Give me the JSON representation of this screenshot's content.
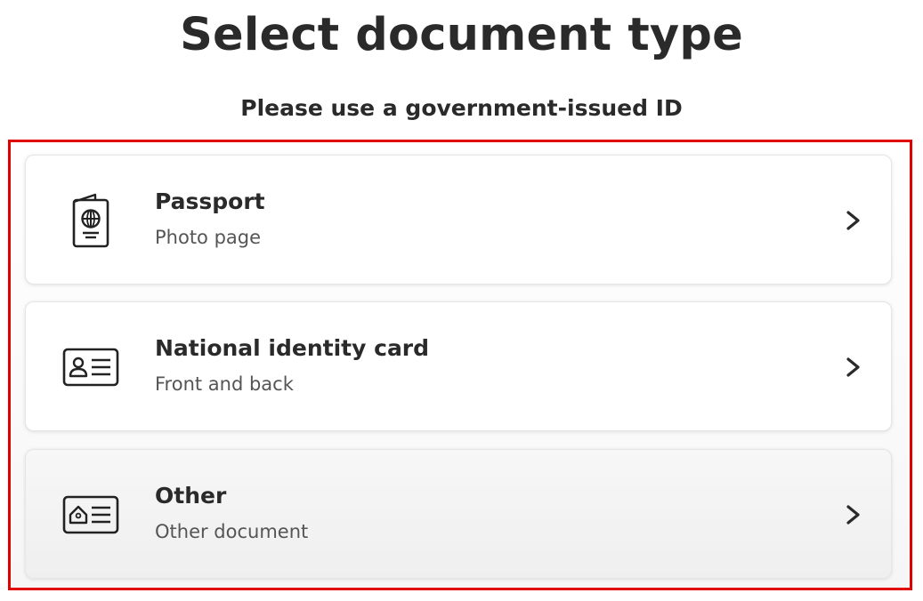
{
  "page": {
    "title": "Select document type",
    "subtitle": "Please use a government-issued ID"
  },
  "options": [
    {
      "title": "Passport",
      "subtitle": "Photo page",
      "icon": "passport-icon"
    },
    {
      "title": "National identity card",
      "subtitle": "Front and back",
      "icon": "id-card-icon"
    },
    {
      "title": "Other",
      "subtitle": "Other document",
      "icon": "other-document-icon"
    }
  ],
  "colors": {
    "highlight_border": "#e00000",
    "text_primary": "#2a2a2a",
    "text_secondary": "#555555"
  }
}
